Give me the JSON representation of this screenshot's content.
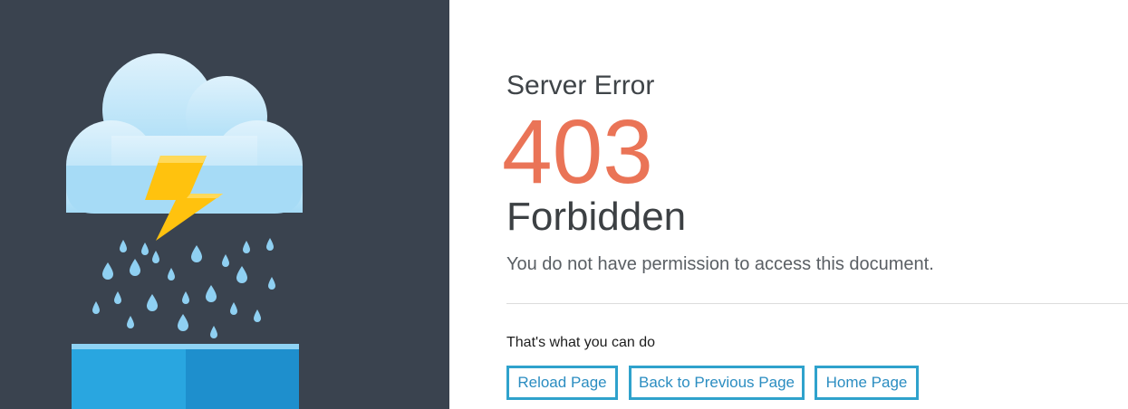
{
  "error": {
    "label": "Server Error",
    "code": "403",
    "title": "Forbidden",
    "message": "You do not have permission to access this document."
  },
  "actions": {
    "heading": "That's what you can do",
    "buttons": {
      "reload": "Reload Page",
      "back": "Back to Previous Page",
      "home": "Home Page"
    }
  },
  "illustration": {
    "icons": [
      "cloud-icon",
      "lightning-bolt-icon",
      "raindrop-icon",
      "water-container-icon"
    ],
    "colors": {
      "panel_background": "#3a434f",
      "cloud_top": "#d6eefb",
      "cloud_bottom": "#a7dcf7",
      "bolt": "#ffc20e",
      "raindrop": "#8fd0f2",
      "container_left": "#29a6e0",
      "container_right": "#1e8fcd"
    }
  },
  "theme": {
    "accent": "#2fa2cc",
    "error_code_color": "#ea7457",
    "text_dark": "#3c4043"
  }
}
